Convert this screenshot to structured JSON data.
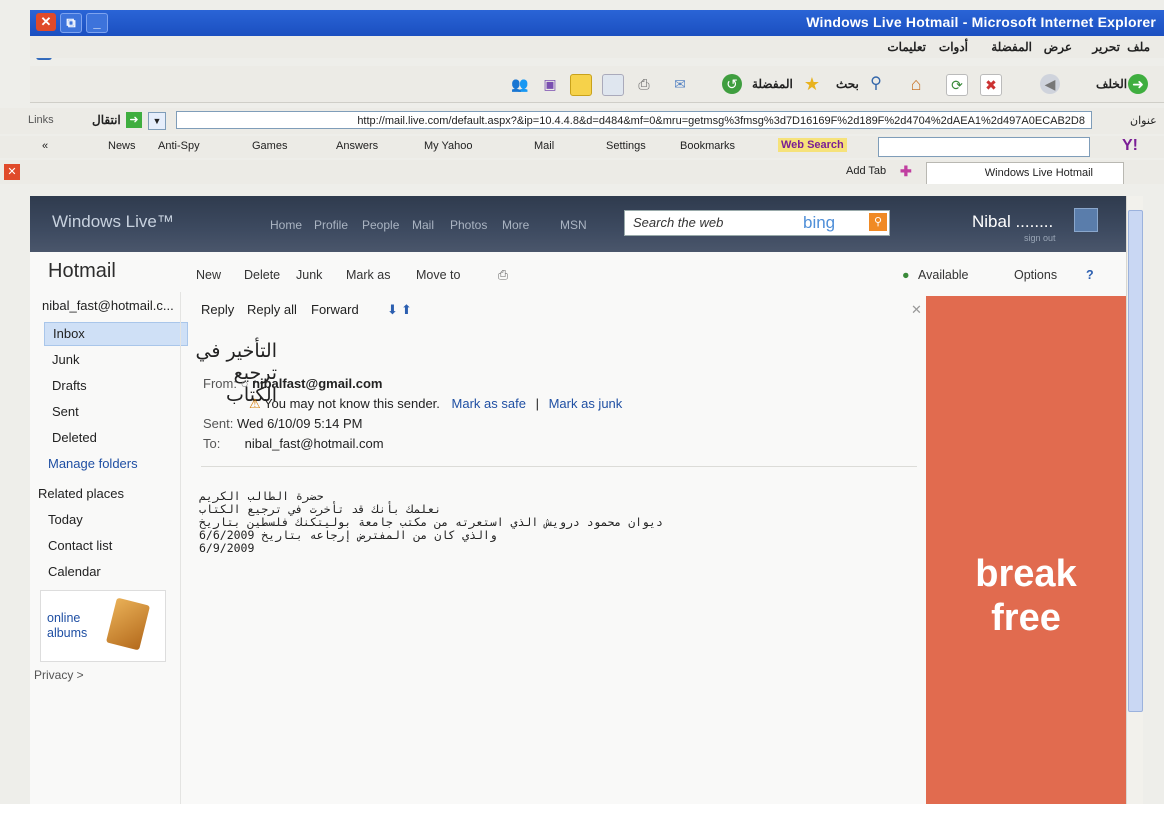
{
  "window": {
    "title": "Windows Live Hotmail - Microsoft Internet Explorer",
    "close": "✕",
    "restore": "⧉",
    "minimize": "_"
  },
  "menu": {
    "items": [
      "ملف",
      "تحرير",
      "عرض",
      "المفضلة",
      "أدوات",
      "تعليمات"
    ]
  },
  "commandbar": {
    "back_label": "الخلف",
    "search_label": "بحث",
    "favorites_label": "المفضلة"
  },
  "address": {
    "label": "عنوان",
    "url": "http://mail.live.com/default.aspx?&ip=10.4.4.8&d=d484&mf=0&mru=getmsg%3fmsg%3d7D16169F%2d189F%2d4704%2dAEA1%2d497A0ECAB2D8",
    "go_label": "انتقال",
    "links_label": "Links"
  },
  "links": {
    "items": [
      "News",
      "Anti-Spy",
      "Games",
      "Answers",
      "My Yahoo",
      "Mail",
      "Settings",
      "Bookmarks"
    ],
    "web_search": "Web Search"
  },
  "tabs": {
    "add_tab": "Add Tab",
    "current": "Windows Live Hotmail"
  },
  "live": {
    "logo": "Windows Live™",
    "nav": [
      "Home",
      "Profile",
      "People",
      "Mail",
      "Photos",
      "More",
      "MSN"
    ],
    "search_placeholder": "Search the web",
    "bing": "bing",
    "user": "Nibal ........",
    "sign_out": "sign out"
  },
  "hotmail": {
    "brand": "Hotmail",
    "account": "nibal_fast@hotmail.c...",
    "commands": [
      "New",
      "Delete",
      "Junk",
      "Mark as",
      "Move to"
    ],
    "status": "Available",
    "options": "Options",
    "folders": [
      "Inbox",
      "Junk",
      "Drafts",
      "Sent",
      "Deleted"
    ],
    "manage_folders": "Manage folders",
    "related_heading": "Related places",
    "related": [
      "Today",
      "Contact list",
      "Calendar"
    ],
    "albums": "online albums",
    "privacy": "Privacy >"
  },
  "message": {
    "reply": "Reply",
    "reply_all": "Reply all",
    "forward": "Forward",
    "subject": "التأخير في ترجيع الكتاب",
    "from_label": "From:",
    "from": "nibalfast@gmail.com",
    "warning": "You may not know this sender.",
    "mark_safe": "Mark as safe",
    "separator": "|",
    "mark_junk": "Mark as junk",
    "sent_label": "Sent:",
    "sent": "Wed 6/10/09 5:14 PM",
    "to_label": "To:",
    "to": "nibal_fast@hotmail.com",
    "body_lines": [
      "حضرة الطالب الكريم",
      "نعلمك بأنك قد تأخرت في ترجيع الكتاب",
      "ديوان محمود درويش الذي استعرته من مكتب جامعة بوليتكنك فلسطين بتاريخ",
      "والذي كان من المفترض إرجاعه بتاريخ 6/6/2009",
      "6/9/2009"
    ]
  },
  "ad": {
    "line1": "break",
    "line2": "free",
    "color": "#e16b4f"
  }
}
